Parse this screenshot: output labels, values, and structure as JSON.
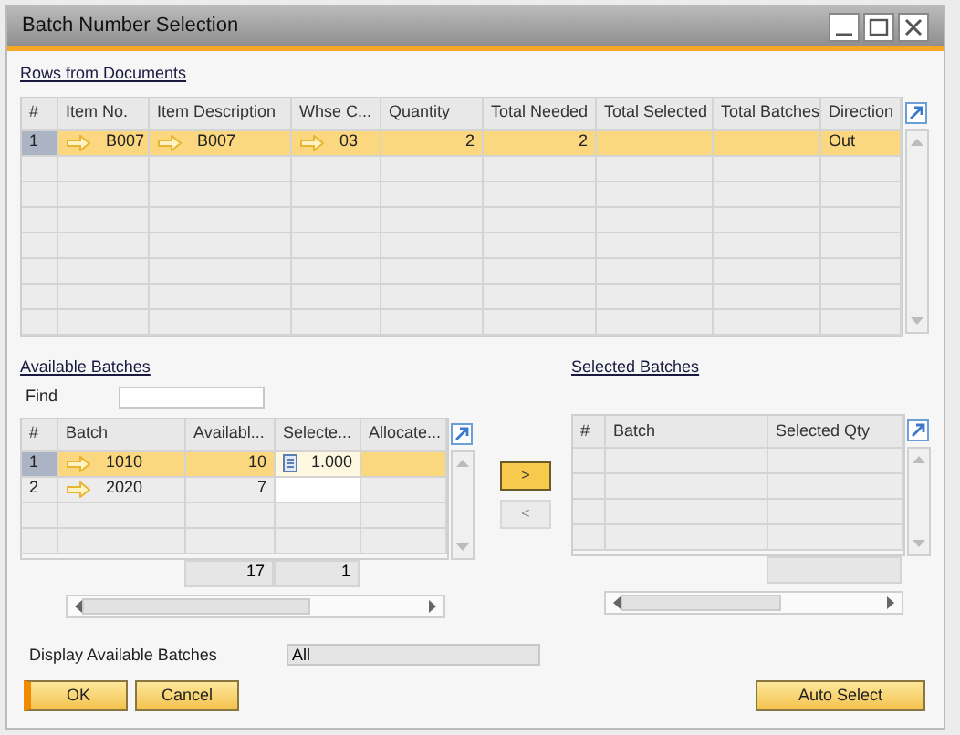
{
  "window": {
    "title": "Batch Number Selection"
  },
  "rows_section": {
    "label": "Rows from Documents",
    "columns": [
      "#",
      "Item No.",
      "Item Description",
      "Whse C...",
      "Quantity",
      "Total Needed",
      "Total Selected",
      "Total Batches",
      "Direction"
    ],
    "rows": [
      {
        "selected": true,
        "cells": [
          {
            "text": "1"
          },
          {
            "text": "B007",
            "link": true
          },
          {
            "text": "B007",
            "link": true
          },
          {
            "text": "03",
            "link": true
          },
          {
            "text": "2",
            "kind": "number"
          },
          {
            "text": "2",
            "kind": "number"
          },
          {},
          {},
          {
            "text": "Out"
          }
        ]
      }
    ]
  },
  "available": {
    "label": "Available Batches",
    "find": {
      "label": "Find"
    },
    "columns": [
      "#",
      "Batch",
      "Availabl...",
      "Selecte...",
      "Allocate..."
    ],
    "rows": [
      {
        "selected": true,
        "cells": [
          {
            "text": "1"
          },
          {
            "text": "1010",
            "link": true
          },
          {
            "text": "10",
            "kind": "number"
          },
          {
            "text": "1.000",
            "kind": "edit"
          },
          {}
        ]
      },
      {
        "selected": false,
        "cells": [
          {
            "text": "2"
          },
          {
            "text": "2020",
            "link": true
          },
          {
            "text": "7",
            "kind": "number"
          },
          {
            "kind": "input"
          },
          {}
        ]
      }
    ],
    "totals": {
      "available": "17",
      "selected": "1"
    }
  },
  "move_buttons": [
    {
      "label": ">",
      "highlighted": true
    },
    {
      "label": "<",
      "highlighted": false
    }
  ],
  "selected": {
    "label": "Selected Batches",
    "columns": [
      "#",
      "Batch",
      "Selected Qty"
    ]
  },
  "display": {
    "label": "Display Available Batches",
    "value": "All"
  },
  "buttons": [
    {
      "label": "OK",
      "default": true
    },
    {
      "label": "Cancel",
      "default": false
    }
  ],
  "auto_select": {
    "label": "Auto Select"
  }
}
